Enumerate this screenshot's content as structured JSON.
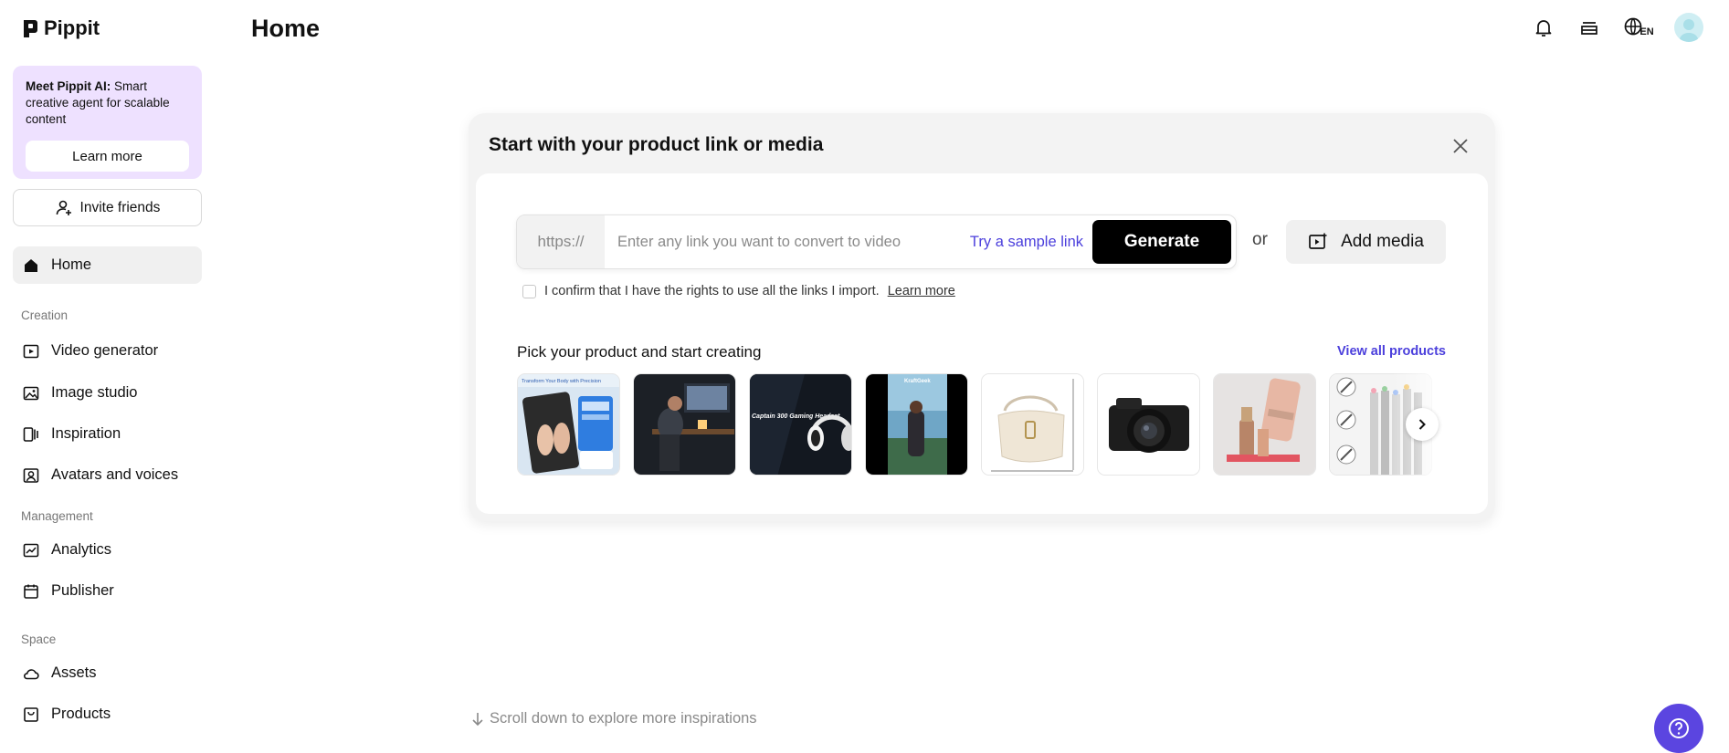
{
  "app": {
    "name": "Pippit"
  },
  "sidebar": {
    "promo": {
      "title": "Meet Pippit AI:",
      "text": " Smart creative agent for scalable content",
      "button": "Learn more"
    },
    "invite_label": "Invite friends",
    "home_label": "Home",
    "sections": {
      "creation": "Creation",
      "management": "Management",
      "space": "Space"
    },
    "creation_items": [
      {
        "label": "Video generator",
        "icon": "video-generator-icon"
      },
      {
        "label": "Image studio",
        "icon": "image-studio-icon"
      },
      {
        "label": "Inspiration",
        "icon": "inspiration-icon"
      },
      {
        "label": "Avatars and voices",
        "icon": "avatar-icon"
      }
    ],
    "management_items": [
      {
        "label": "Analytics",
        "icon": "analytics-icon"
      },
      {
        "label": "Publisher",
        "icon": "calendar-icon"
      }
    ],
    "space_items": [
      {
        "label": "Assets",
        "icon": "cloud-icon"
      },
      {
        "label": "Products",
        "icon": "product-box-icon"
      }
    ]
  },
  "header": {
    "title": "Home",
    "language": "EN"
  },
  "card": {
    "title": "Start with your product link or media",
    "url_prefix": "https://",
    "url_placeholder": "Enter any link you want to convert to video",
    "sample_link": "Try a sample link",
    "generate_label": "Generate",
    "or_label": "or",
    "add_media_label": "Add media",
    "confirm_text": "I confirm that I have the rights to use all the links I import.",
    "confirm_link": "Learn more",
    "pick_title": "Pick your product and start creating",
    "view_all": "View all products",
    "products": [
      {
        "name": "smart-scale",
        "caption": "Transform Your Body with Precision"
      },
      {
        "name": "desk-workspace",
        "caption": ""
      },
      {
        "name": "gaming-headset",
        "caption": "Captain 300 Gaming Headset"
      },
      {
        "name": "outdoor-video",
        "caption": ""
      },
      {
        "name": "handbag",
        "caption": ""
      },
      {
        "name": "camera",
        "caption": ""
      },
      {
        "name": "cosmetics",
        "caption": ""
      },
      {
        "name": "pencils",
        "caption": ""
      }
    ]
  },
  "scroll_hint": "Scroll down to explore more inspirations",
  "colors": {
    "accent": "#4b3fdc",
    "promo_bg": "#eee1ff",
    "help_bg": "#5b45e0"
  }
}
